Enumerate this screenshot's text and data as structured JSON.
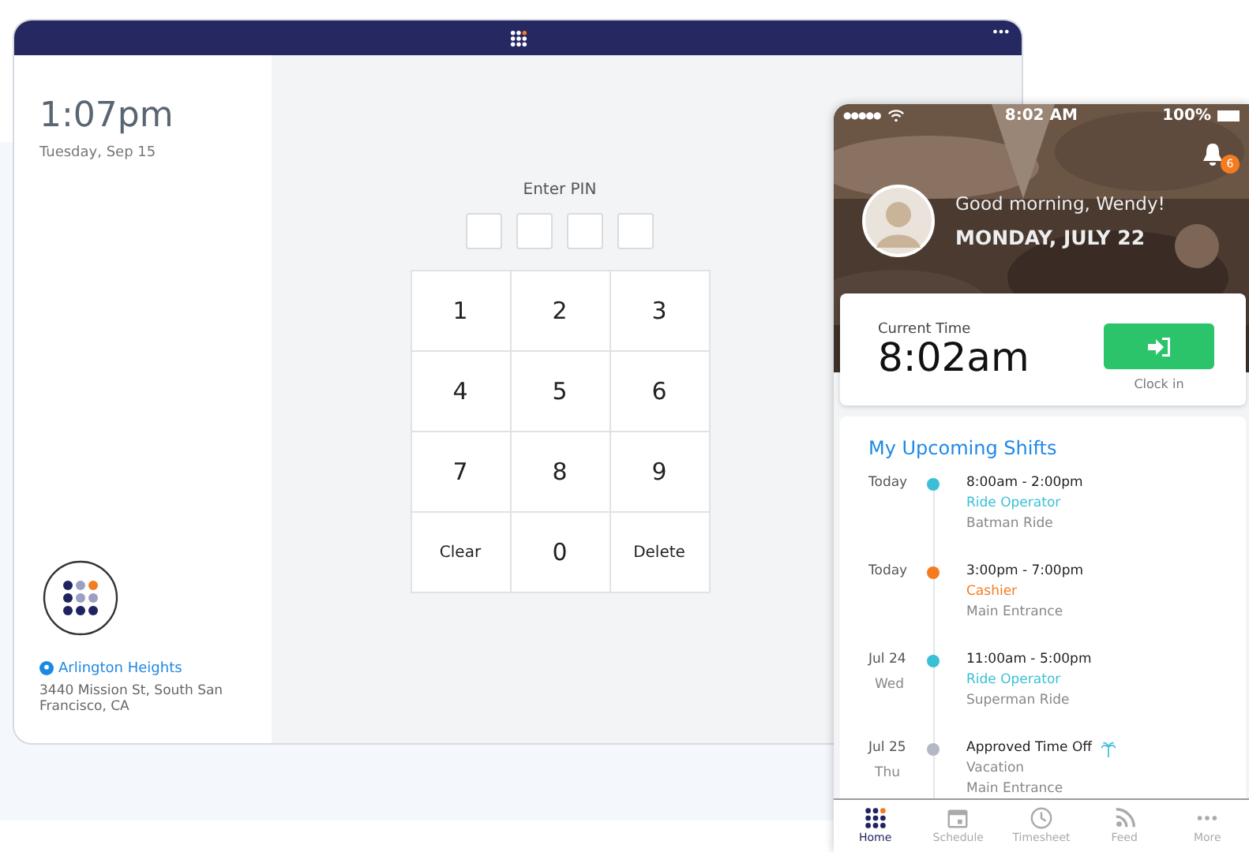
{
  "tablet": {
    "menu_icon": "•••",
    "clock": {
      "time": "1:07pm",
      "date": "Tuesday, Sep 15"
    },
    "location": {
      "name": "Arlington Heights",
      "address": "3440 Mission St, South San Francisco, CA"
    },
    "pin": {
      "label": "Enter PIN"
    },
    "keypad": [
      {
        "label": "1",
        "kind": "digit"
      },
      {
        "label": "2",
        "kind": "digit"
      },
      {
        "label": "3",
        "kind": "digit"
      },
      {
        "label": "4",
        "kind": "digit"
      },
      {
        "label": "5",
        "kind": "digit"
      },
      {
        "label": "6",
        "kind": "digit"
      },
      {
        "label": "7",
        "kind": "digit"
      },
      {
        "label": "8",
        "kind": "digit"
      },
      {
        "label": "9",
        "kind": "digit"
      },
      {
        "label": "Clear",
        "kind": "action"
      },
      {
        "label": "0",
        "kind": "digit"
      },
      {
        "label": "Delete",
        "kind": "action"
      }
    ]
  },
  "phone": {
    "status_bar": {
      "signal": "●●●●●",
      "time": "8:02 AM",
      "battery": "100%"
    },
    "notifications": "6",
    "greeting": "Good morning, Wendy!",
    "date": "MONDAY, JULY 22",
    "current_time": {
      "label": "Current Time",
      "value": "8:02am",
      "button": "Clock in"
    },
    "shifts_title": "My Upcoming Shifts",
    "shifts": [
      {
        "kind": "shift",
        "date": "Today",
        "color": "#3bbfd6",
        "time": "8:00am - 2:00pm",
        "role": "Ride Operator",
        "location": "Batman Ride"
      },
      {
        "kind": "shift",
        "date": "Today",
        "color": "#f47b20",
        "time": "3:00pm - 7:00pm",
        "role": "Cashier",
        "location": "Main Entrance"
      },
      {
        "kind": "shift",
        "date": "Jul 24",
        "day": "Wed",
        "color": "#3bbfd6",
        "time": "11:00am - 5:00pm",
        "role": "Ride Operator",
        "location": "Superman Ride"
      },
      {
        "kind": "time_off",
        "date": "Jul 25",
        "day": "Thu",
        "color": "#b4b8c5",
        "time": "Approved Time Off",
        "role": "Vacation",
        "location": "Main Entrance"
      }
    ],
    "tabs": [
      {
        "label": "Home",
        "selected": true
      },
      {
        "label": "Schedule",
        "selected": false
      },
      {
        "label": "Timesheet",
        "selected": false
      },
      {
        "label": "Feed",
        "selected": false
      },
      {
        "label": "More",
        "selected": false
      }
    ]
  }
}
